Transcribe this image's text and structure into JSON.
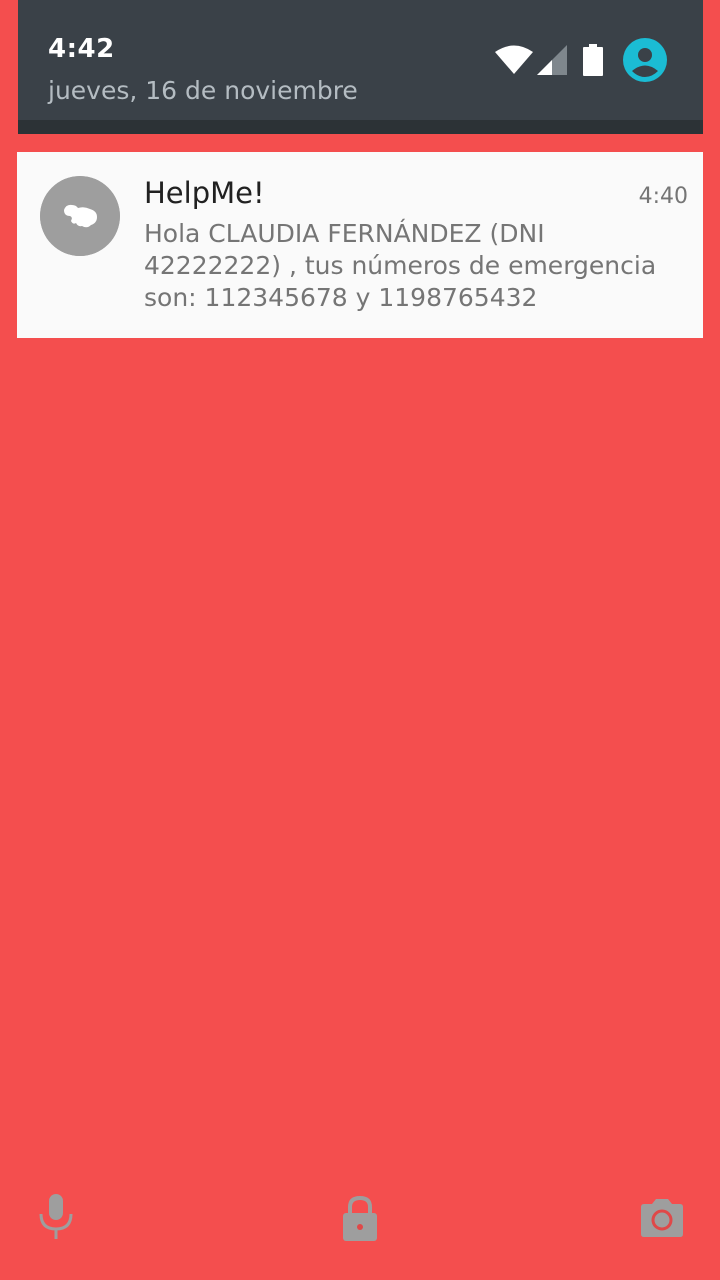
{
  "colors": {
    "background": "#f44e4e",
    "header": "#3a4148",
    "header_shadow": "#2c3236",
    "notification_bg": "#fafafa",
    "accent": "#1bbcd4",
    "icon_gray": "#9e9e9e"
  },
  "status_bar": {
    "time": "4:42",
    "date": "jueves, 16 de noviembre",
    "icons": [
      "wifi-icon",
      "signal-icon",
      "battery-icon",
      "account-icon"
    ]
  },
  "notification": {
    "app_icon": "helpme-app-icon",
    "title": "HelpMe!",
    "time": "4:40",
    "text": "Hola CLAUDIA FERNÁNDEZ (DNI 42222222) , tus números de emergencia son: 112345678 y 1198765432"
  },
  "bottom_affordances": [
    "mic-icon",
    "lock-icon",
    "camera-icon"
  ]
}
